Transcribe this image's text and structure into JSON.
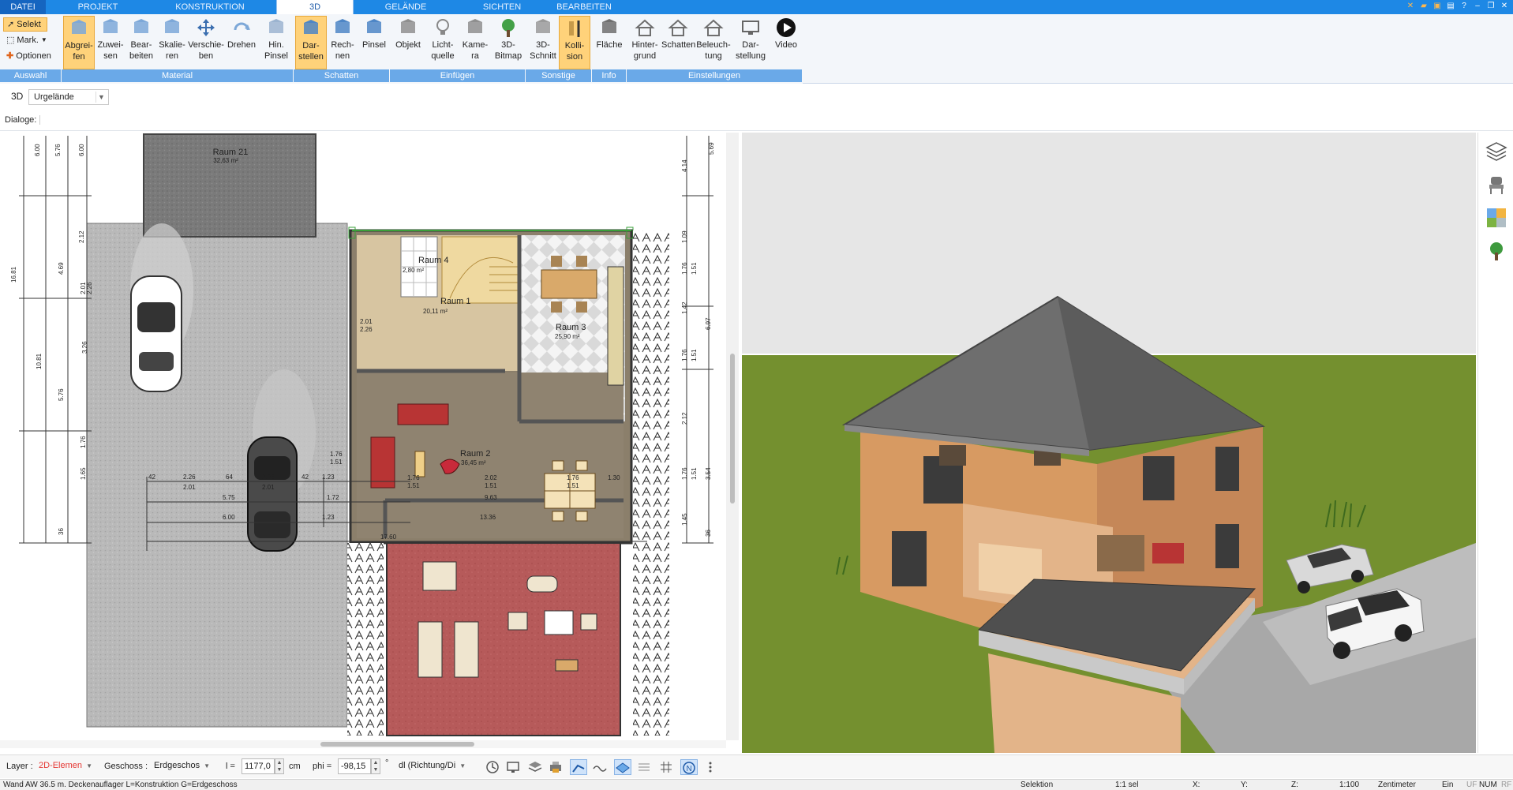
{
  "menubar": {
    "tabs": [
      {
        "label": "DATEI",
        "active": false
      },
      {
        "label": "PROJEKT",
        "active": false
      },
      {
        "label": "KONSTRUKTION",
        "active": false
      },
      {
        "label": "3D",
        "active": true
      },
      {
        "label": "GELÄNDE",
        "active": false
      },
      {
        "label": "SICHTEN",
        "active": false
      },
      {
        "label": "BEARBEITEN",
        "active": false
      }
    ]
  },
  "ribbon": {
    "selection": {
      "select_label": "Selekt",
      "mark_label": "Mark.",
      "options_label": "Optionen"
    },
    "buttons": [
      {
        "label": "Abgrei-\nfen",
        "icon": "eyedropper-icon",
        "active": true
      },
      {
        "label": "Zuwei-\nsen",
        "icon": "assign-icon",
        "active": false
      },
      {
        "label": "Bear-\nbeiten",
        "icon": "edit-material-icon",
        "active": false
      },
      {
        "label": "Skalie-\nren",
        "icon": "scale-icon",
        "active": false
      },
      {
        "label": "Verschie-\nben",
        "icon": "move-icon",
        "active": false
      },
      {
        "label": "Drehen",
        "icon": "rotate-icon",
        "active": false
      },
      {
        "label": "Hin.\nPinsel",
        "icon": "background-brush-icon",
        "active": false
      },
      {
        "label": "Dar-\nstellen",
        "icon": "cube-shadow-icon",
        "active": true
      },
      {
        "label": "Rech-\nnen",
        "icon": "calculate-icon",
        "active": false
      },
      {
        "label": "Pinsel",
        "icon": "brush-icon",
        "active": false
      },
      {
        "label": "Objekt",
        "icon": "object-chair-icon",
        "active": false
      },
      {
        "label": "Licht-\nquelle",
        "icon": "lightbulb-icon",
        "active": false
      },
      {
        "label": "Kame-\nra",
        "icon": "camera-person-icon",
        "active": false
      },
      {
        "label": "3D-\nBitmap",
        "icon": "tree-icon",
        "active": false
      },
      {
        "label": "3D-\nSchnitt",
        "icon": "section-icon",
        "active": false
      },
      {
        "label": "Kolli-\nsion",
        "icon": "collision-icon",
        "active": true
      },
      {
        "label": "Fläche",
        "icon": "area-icon",
        "active": false
      },
      {
        "label": "Hinter-\ngrund",
        "icon": "background-icon",
        "active": false
      },
      {
        "label": "Schatten",
        "icon": "house-shadow-icon",
        "active": false
      },
      {
        "label": "Beleuch-\ntung",
        "icon": "lighting-house-icon",
        "active": false
      },
      {
        "label": "Dar-\nstellung",
        "icon": "display-monitor-icon",
        "active": false
      },
      {
        "label": "Video",
        "icon": "play-icon",
        "active": false
      }
    ],
    "groups": [
      {
        "label": "Auswahl"
      },
      {
        "label": "Material"
      },
      {
        "label": "Schatten"
      },
      {
        "label": "Einfügen"
      },
      {
        "label": "Sonstige"
      },
      {
        "label": "Info"
      },
      {
        "label": "Einstellungen"
      }
    ]
  },
  "toolbar": {
    "mode_label": "3D",
    "terrain_value": "Urgelände",
    "dialoge_label": "Dialoge:"
  },
  "plan": {
    "rooms": [
      {
        "name": "Raum 21",
        "area": "32,63 m²"
      },
      {
        "name": "Raum 4",
        "area": "2,80 m²"
      },
      {
        "name": "Raum 1",
        "area": "20,11 m²"
      },
      {
        "name": "Raum 3",
        "area": "25,90 m²"
      },
      {
        "name": "Raum 2",
        "area": "36,45 m²"
      }
    ],
    "dims_left": [
      "6.00",
      "5.76",
      "6.00",
      "16.81",
      "2.12",
      "4.69",
      "2.01",
      "2.26",
      "10.81",
      "3.26",
      "5.76",
      "1.76",
      "1.65",
      "36"
    ],
    "dims_right": [
      "5.69",
      "4.14",
      "1.09",
      "1.76",
      "1.51",
      "1.42",
      "6.97",
      "1.76",
      "1.51",
      "2.12",
      "3.54",
      "1.76",
      "1.51",
      "1.45",
      "36"
    ],
    "dims_bottom": [
      "42",
      "2.26",
      "2.01",
      "64",
      "2.26",
      "2.01",
      "42",
      "1.23",
      "5.75",
      "1.72",
      "6.00",
      "1.23",
      "1.76",
      "1.51",
      "2.02",
      "1.51",
      "1.76",
      "1.51",
      "1.30",
      "9.63",
      "13.36",
      "17.60"
    ],
    "small_marks": [
      "1.76",
      "2.01",
      "2.26",
      "1.76",
      "1.51"
    ]
  },
  "sidebar_right": {
    "icons": [
      "layers-icon",
      "chair-icon",
      "material-swatch-icon",
      "plant-tree-icon"
    ]
  },
  "inputbar": {
    "layer_label": "Layer :",
    "layer_value": "2D-Elemen",
    "geschoss_label": "Geschoss :",
    "geschoss_value": "Erdgeschos",
    "l_label": "l =",
    "l_value": "1177,0",
    "l_unit": "cm",
    "phi_label": "phi =",
    "phi_value": "-98,15",
    "phi_unit": "°",
    "direction_value": "dl (Richtung/Di",
    "tool_icons": [
      "clock-icon",
      "screen-icon",
      "layers-stack-icon",
      "printer-icon",
      "snap-line-icon",
      "snap-wave-icon",
      "snap-plane-icon",
      "snap-hatch-icon",
      "grid-icon",
      "north-icon",
      "more-vertical-icon"
    ]
  },
  "statusbar": {
    "message": "Wand AW 36.5 m. Deckenauflager L=Konstruktion G=Erdgeschoss",
    "mode": "Selektion",
    "selection_count": "1:1 sel",
    "x_label": "X:",
    "y_label": "Y:",
    "z_label": "Z:",
    "scale": "1:100",
    "unit": "Zentimeter",
    "ein": "Ein",
    "uf": "UF",
    "num": "NUM",
    "rf": "RF"
  },
  "colors": {
    "accent": "#1e88e5",
    "ribbon_group": "#6aa9e8",
    "active_tool": "#ffd27a",
    "room_red": "#b65a5a",
    "grass": "#74902f"
  }
}
